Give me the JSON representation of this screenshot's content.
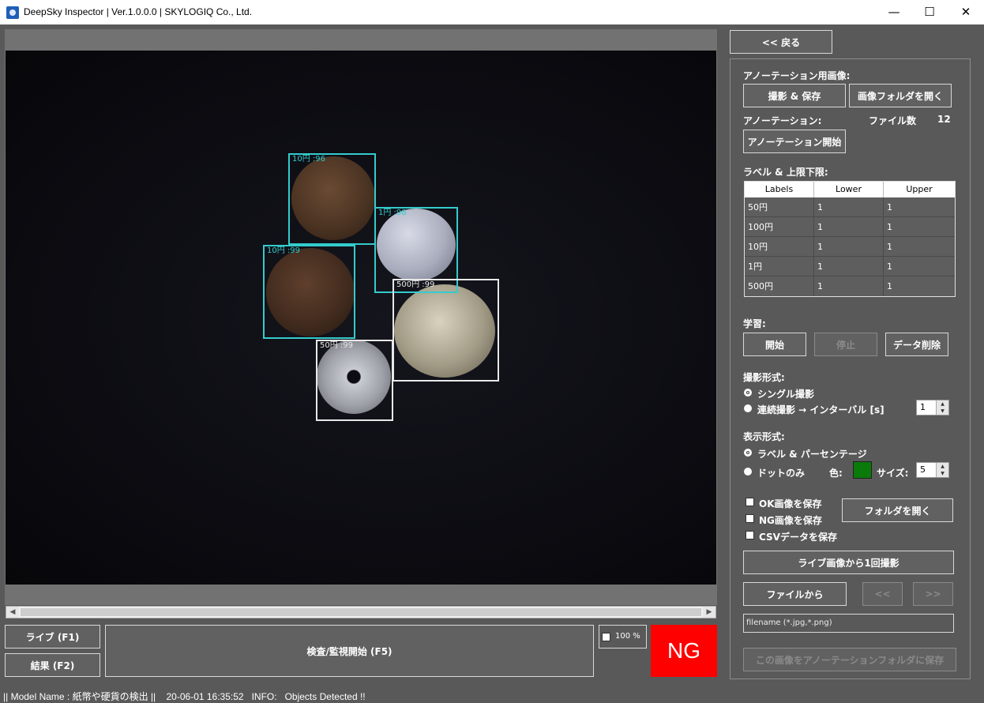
{
  "window": {
    "title": "DeepSky Inspector | Ver.1.0.0.0 | SKYLOGIQ Co., Ltd.",
    "minimize": "—",
    "maximize": "☐",
    "close": "✕"
  },
  "detections": [
    {
      "label": "10円 :96",
      "color": "#33cccc"
    },
    {
      "label": "1円 :98",
      "color": "#33cccc"
    },
    {
      "label": "10円 :99",
      "color": "#33cccc"
    },
    {
      "label": "500円 :99",
      "color": "#e8e8e8"
    },
    {
      "label": "50円 :99",
      "color": "#e8e8e8"
    }
  ],
  "scrollbar": {
    "left": "◀",
    "right": "▶"
  },
  "bottom": {
    "live_button": "ライブ (F1)",
    "result_button": "結果 (F2)",
    "inspect_button": "検査/監視開始 (F5)",
    "zoom_label": "100 %",
    "verdict": "NG"
  },
  "status_bar": "|| Model Name : 紙幣や硬貨の検出 ||    20-06-01 16:35:52   INFO:   Objects Detected !!",
  "panel": {
    "back_button": "<< 戻る",
    "annotation_image_title": "アノーテーション用画像:",
    "capture_save_button": "撮影 & 保存",
    "open_image_folder_button": "画像フォルダを開く",
    "annotation_title": "アノーテーション:",
    "file_count_label": "ファイル数",
    "file_count": "12",
    "annotation_start_button": "アノーテーション開始",
    "labels_title": "ラベル & 上限下限:",
    "table_headers": [
      "Labels",
      "Lower",
      "Upper"
    ],
    "table_rows": [
      [
        "50円",
        "1",
        "1"
      ],
      [
        "100円",
        "1",
        "1"
      ],
      [
        "10円",
        "1",
        "1"
      ],
      [
        "1円",
        "1",
        "1"
      ],
      [
        "500円",
        "1",
        "1"
      ]
    ],
    "training_title": "学習:",
    "train_start_button": "開始",
    "train_stop_button": "停止",
    "data_delete_button": "データ削除",
    "capture_mode_title": "撮影形式:",
    "single_capture": "シングル撮影",
    "continuous_capture": "連続撮影 → インターバル [s]",
    "interval_value": "1",
    "display_mode_title": "表示形式:",
    "label_percentage": "ラベル & パーセンテージ",
    "dot_only": "ドットのみ",
    "color_label": "色:",
    "dot_color": "#0a7a0a",
    "size_label": "サイズ:",
    "size_value": "5",
    "save_ok": "OK画像を保存",
    "save_ng": "NG画像を保存",
    "save_csv": "CSVデータを保存",
    "open_folder_button": "フォルダを開く",
    "capture_once_button": "ライブ画像から1回撮影",
    "from_file_button": "ファイルから",
    "prev_button": "<<",
    "next_button": ">>",
    "filename_placeholder": "filename (*.jpg,*.png)",
    "save_to_annotation_button": "この画像をアノーテーションフォルダに保存"
  }
}
